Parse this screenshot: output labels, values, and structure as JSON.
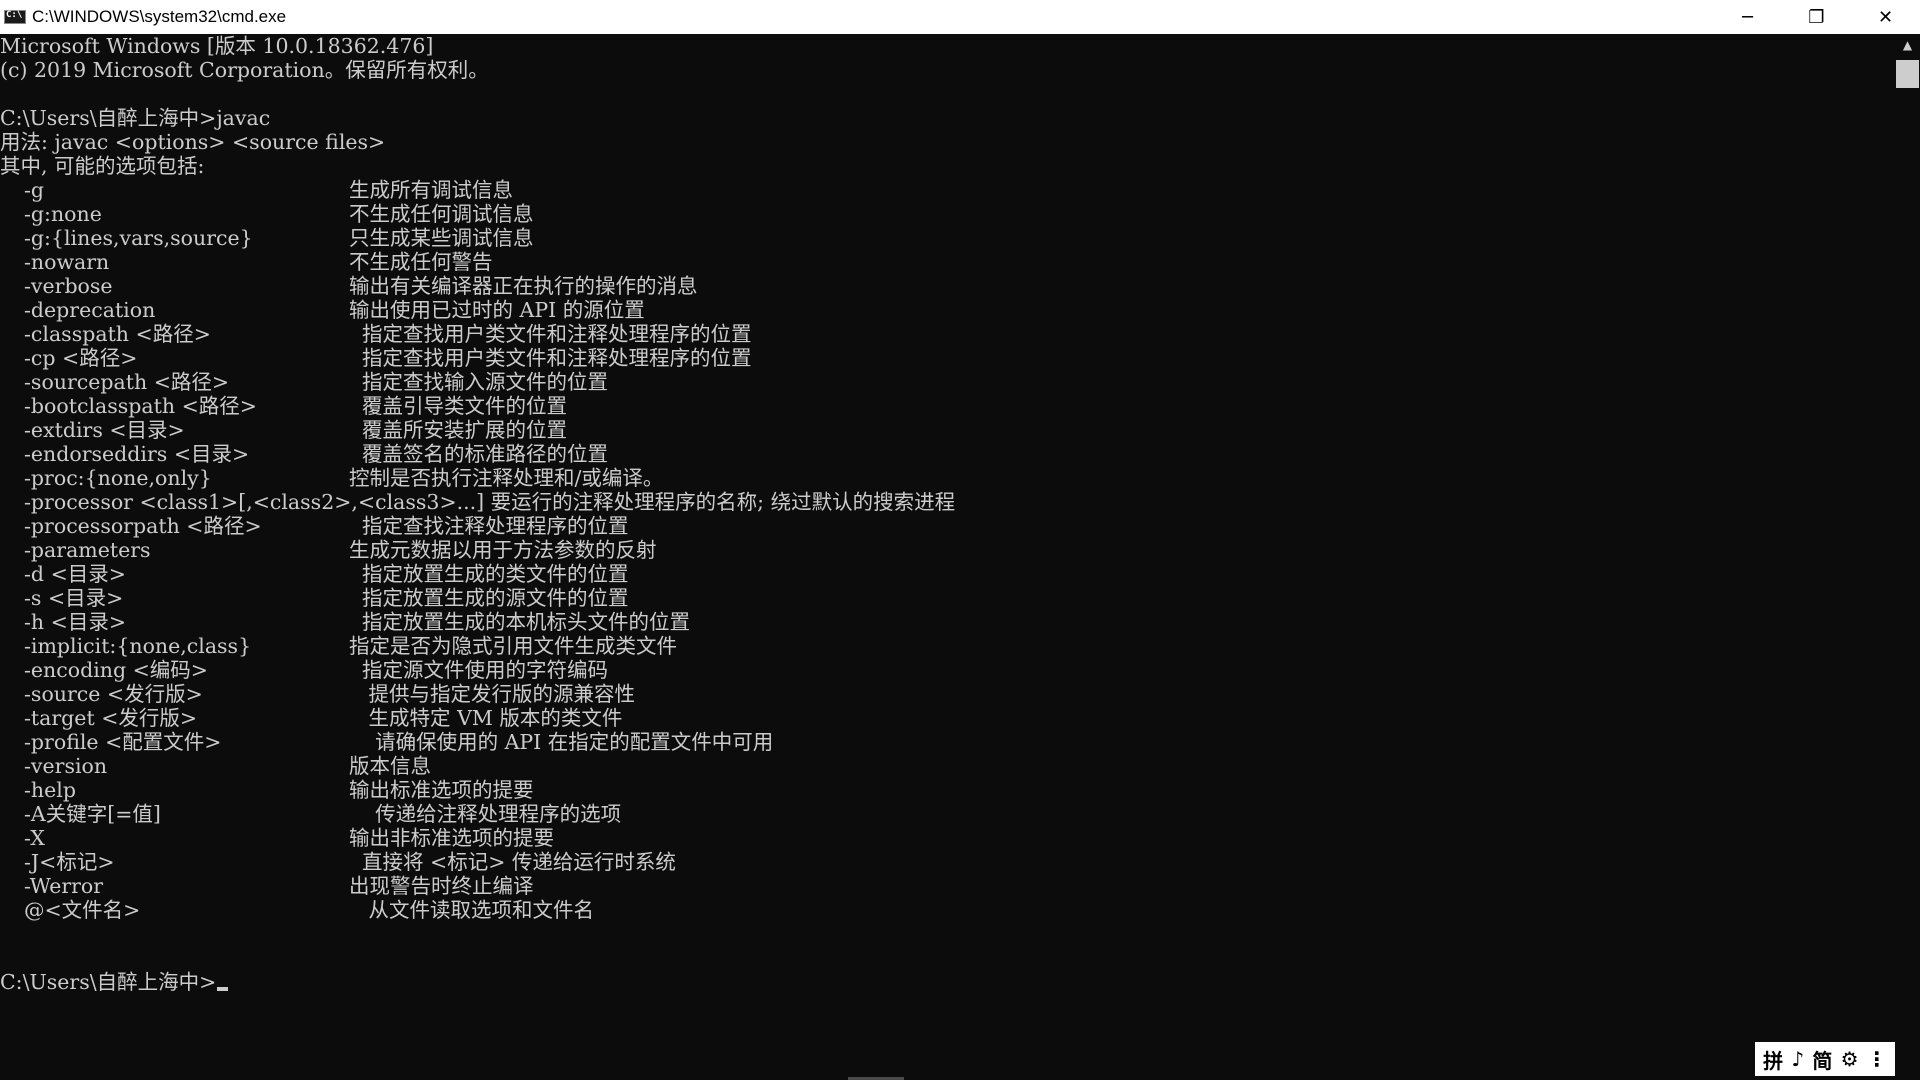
{
  "window": {
    "title": "C:\\WINDOWS\\system32\\cmd.exe",
    "minimize": "─",
    "restore": "❐",
    "close": "✕"
  },
  "console": {
    "header": [
      "Microsoft Windows [版本 10.0.18362.476]",
      "(c) 2019 Microsoft Corporation。保留所有权利。"
    ],
    "prompt1": "C:\\Users\\自醉上海中>javac",
    "usage": "用法: javac <options> <source files>",
    "options_intro": "其中, 可能的选项包括:",
    "options": [
      {
        "opt": "-g",
        "desc": "生成所有调试信息"
      },
      {
        "opt": "-g:none",
        "desc": "不生成任何调试信息"
      },
      {
        "opt": "-g:{lines,vars,source}",
        "desc": "只生成某些调试信息"
      },
      {
        "opt": "-nowarn",
        "desc": "不生成任何警告"
      },
      {
        "opt": "-verbose",
        "desc": "输出有关编译器正在执行的操作的消息"
      },
      {
        "opt": "-deprecation",
        "desc": "输出使用已过时的 API 的源位置"
      },
      {
        "opt": "-classpath <路径>",
        "desc": "  指定查找用户类文件和注释处理程序的位置"
      },
      {
        "opt": "-cp <路径>",
        "desc": "  指定查找用户类文件和注释处理程序的位置"
      },
      {
        "opt": "-sourcepath <路径>",
        "desc": "  指定查找输入源文件的位置"
      },
      {
        "opt": "-bootclasspath <路径>",
        "desc": "  覆盖引导类文件的位置"
      },
      {
        "opt": "-extdirs <目录>",
        "desc": "  覆盖所安装扩展的位置"
      },
      {
        "opt": "-endorseddirs <目录>",
        "desc": "  覆盖签名的标准路径的位置"
      },
      {
        "opt": "-proc:{none,only}",
        "desc": "控制是否执行注释处理和/或编译。"
      },
      {
        "opt": "-processor <class1>[,<class2>,<class3>...] 要运行的注释处理程序的名称; 绕过默认的搜索进程",
        "desc": ""
      },
      {
        "opt": "-processorpath <路径>",
        "desc": "  指定查找注释处理程序的位置"
      },
      {
        "opt": "-parameters",
        "desc": "生成元数据以用于方法参数的反射"
      },
      {
        "opt": "-d <目录>",
        "desc": "  指定放置生成的类文件的位置"
      },
      {
        "opt": "-s <目录>",
        "desc": "  指定放置生成的源文件的位置"
      },
      {
        "opt": "-h <目录>",
        "desc": "  指定放置生成的本机标头文件的位置"
      },
      {
        "opt": "-implicit:{none,class}",
        "desc": "指定是否为隐式引用文件生成类文件"
      },
      {
        "opt": "-encoding <编码>",
        "desc": "  指定源文件使用的字符编码"
      },
      {
        "opt": "-source <发行版>",
        "desc": "   提供与指定发行版的源兼容性"
      },
      {
        "opt": "-target <发行版>",
        "desc": "   生成特定 VM 版本的类文件"
      },
      {
        "opt": "-profile <配置文件>",
        "desc": "    请确保使用的 API 在指定的配置文件中可用"
      },
      {
        "opt": "-version",
        "desc": "版本信息"
      },
      {
        "opt": "-help",
        "desc": "输出标准选项的提要"
      },
      {
        "opt": "-A关键字[=值]",
        "desc": "    传递给注释处理程序的选项"
      },
      {
        "opt": "-X",
        "desc": "输出非标准选项的提要"
      },
      {
        "opt": "-J<标记>",
        "desc": "  直接将 <标记> 传递给运行时系统"
      },
      {
        "opt": "-Werror",
        "desc": "出现警告时终止编译"
      },
      {
        "opt": "@<文件名>",
        "desc": "   从文件读取选项和文件名"
      }
    ],
    "prompt2": "C:\\Users\\自醉上海中>"
  },
  "ime": {
    "items": [
      "拼",
      "♪",
      "简",
      "⚙",
      "⋮"
    ]
  }
}
